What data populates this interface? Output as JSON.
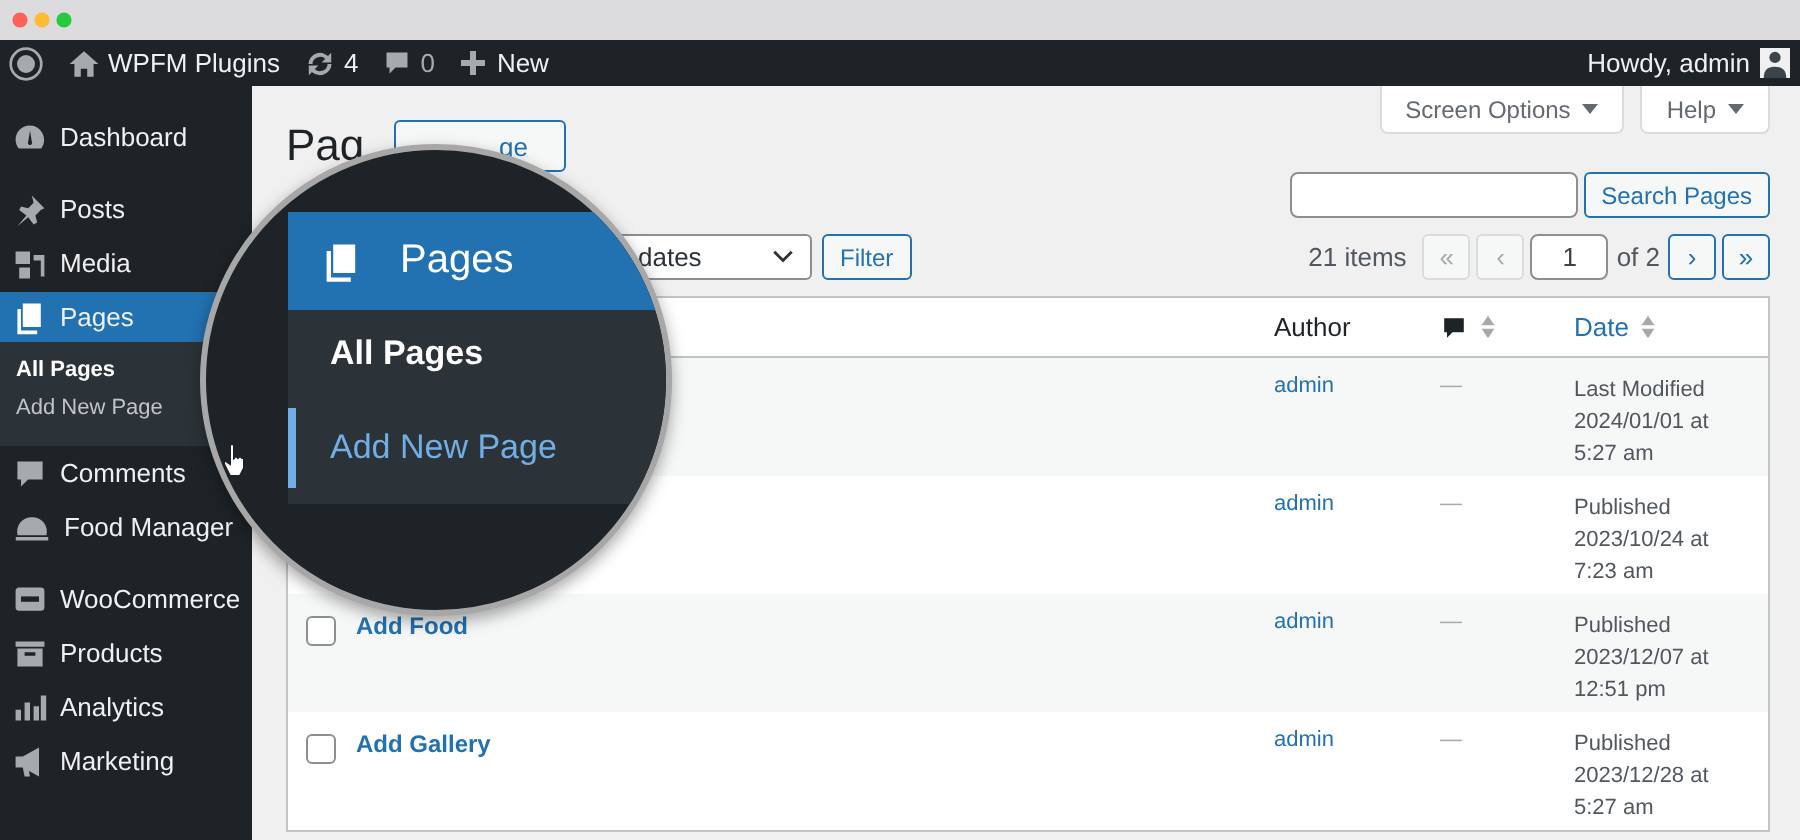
{
  "admin_bar": {
    "site": "WPFM Plugins",
    "updates": "4",
    "comments": "0",
    "new": "New",
    "greeting": "Howdy, admin"
  },
  "sidebar": {
    "groups": [
      [
        {
          "label": "Dashboard",
          "selected": false
        }
      ],
      [
        {
          "label": "Posts",
          "selected": false
        },
        {
          "label": "Media",
          "selected": false
        },
        {
          "label": "Pages",
          "selected": true,
          "children": [
            {
              "label": "All Pages",
              "selected": true
            },
            {
              "label": "Add New Page",
              "selected": false
            }
          ]
        },
        {
          "label": "Comments",
          "selected": false
        },
        {
          "label": "Food Manager",
          "selected": false
        }
      ],
      [
        {
          "label": "WooCommerce",
          "selected": false
        },
        {
          "label": "Products",
          "selected": false
        },
        {
          "label": "Analytics",
          "selected": false
        },
        {
          "label": "Marketing",
          "selected": false
        }
      ]
    ]
  },
  "header": {
    "title": "Pag",
    "add_button": "ge",
    "screen_options": "Screen Options",
    "help": "Help"
  },
  "search": {
    "button": "Search Pages"
  },
  "filters": {
    "date_select": "dates",
    "filter_button": "Filter"
  },
  "pagination": {
    "count": "21 items",
    "first": {
      "label": "«",
      "disabled": true
    },
    "prev": {
      "label": "‹",
      "disabled": true
    },
    "page": "1",
    "total": "of 2",
    "next": {
      "label": "›",
      "disabled": false
    },
    "last": {
      "label": "»",
      "disabled": false
    }
  },
  "table": {
    "columns": [
      {
        "kind": "author",
        "label": "Author",
        "sortable": false
      },
      {
        "kind": "comments",
        "sortable": true
      },
      {
        "kind": "date",
        "label": "Date",
        "sortable": true
      }
    ],
    "rows": [
      {
        "author": "admin",
        "comments": "—",
        "status": "Last Modified",
        "date": "2024/01/01 at 5:27 am"
      },
      {
        "author": "admin",
        "comments": "—",
        "status": "Published",
        "date": "2023/10/24 at 7:23 am"
      },
      {
        "checked": false,
        "title": "Add Food",
        "author": "admin",
        "comments": "—",
        "status": "Published",
        "date": "2023/12/07 at 12:51 pm"
      },
      {
        "checked": false,
        "title": "Add Gallery",
        "author": "admin",
        "comments": "—",
        "status": "Published",
        "date": "2023/12/28 at 5:27 am"
      }
    ]
  },
  "magnifier": {
    "heading": "Pages",
    "items": [
      {
        "label": "All Pages",
        "selected": true,
        "highlighted": false
      },
      {
        "label": "Add New Page",
        "selected": false,
        "highlighted": true
      }
    ]
  }
}
